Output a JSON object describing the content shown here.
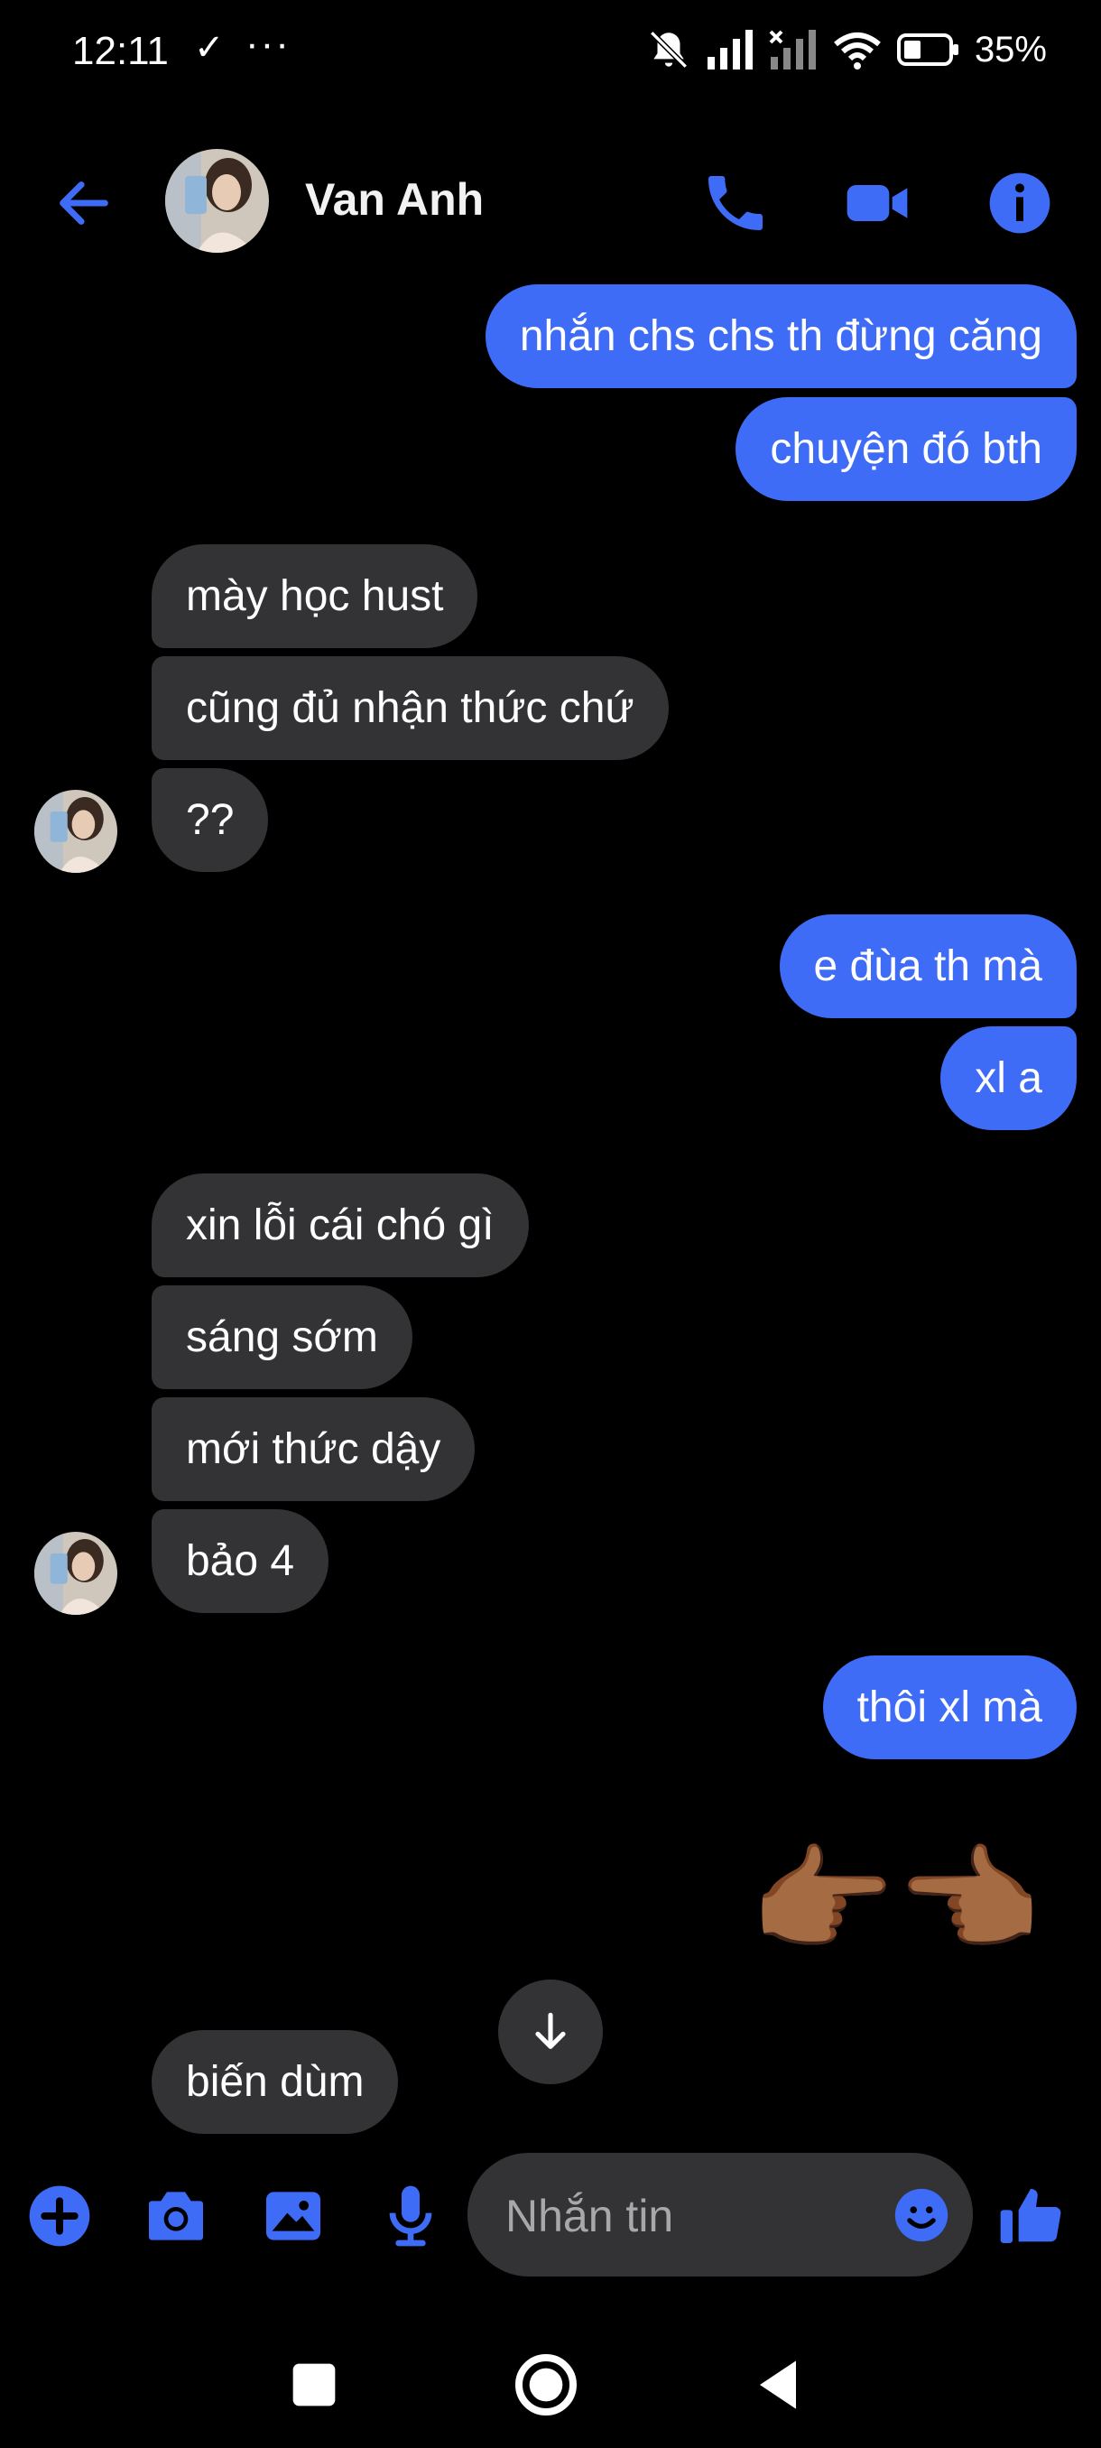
{
  "status_bar": {
    "time": "12:11",
    "check": "✓",
    "more": "···",
    "battery": "35%"
  },
  "header": {
    "contact_name": "Van Anh"
  },
  "messages": [
    {
      "dir": "out",
      "pos": "top",
      "text": "nhắn chs chs th đừng căng"
    },
    {
      "dir": "out",
      "pos": "bottom",
      "text": "chuyện đó bth"
    },
    {
      "dir": "in",
      "pos": "top",
      "text": "mày học hust"
    },
    {
      "dir": "in",
      "pos": "mid",
      "text": "cũng đủ nhận thức chứ"
    },
    {
      "dir": "in",
      "pos": "bottom",
      "text": "??"
    },
    {
      "dir": "out",
      "pos": "top",
      "text": "e đùa th mà"
    },
    {
      "dir": "out",
      "pos": "bottom",
      "text": "xl a"
    },
    {
      "dir": "in",
      "pos": "top",
      "text": "xin lỗi cái chó gì"
    },
    {
      "dir": "in",
      "pos": "mid",
      "text": "sáng sớm"
    },
    {
      "dir": "in",
      "pos": "mid",
      "text": "mới thức dậy"
    },
    {
      "dir": "in",
      "pos": "bottom",
      "text": "bảo 4"
    },
    {
      "dir": "out",
      "pos": "single",
      "text": "thôi xl mà"
    },
    {
      "dir": "in",
      "pos": "single",
      "text": "biến dùm"
    }
  ],
  "emoji_message": "👉🏾👈🏾",
  "composer": {
    "placeholder": "Nhắn tin"
  },
  "colors": {
    "accent": "#3f6cf6",
    "incoming_bubble": "#333335",
    "background": "#000000"
  }
}
